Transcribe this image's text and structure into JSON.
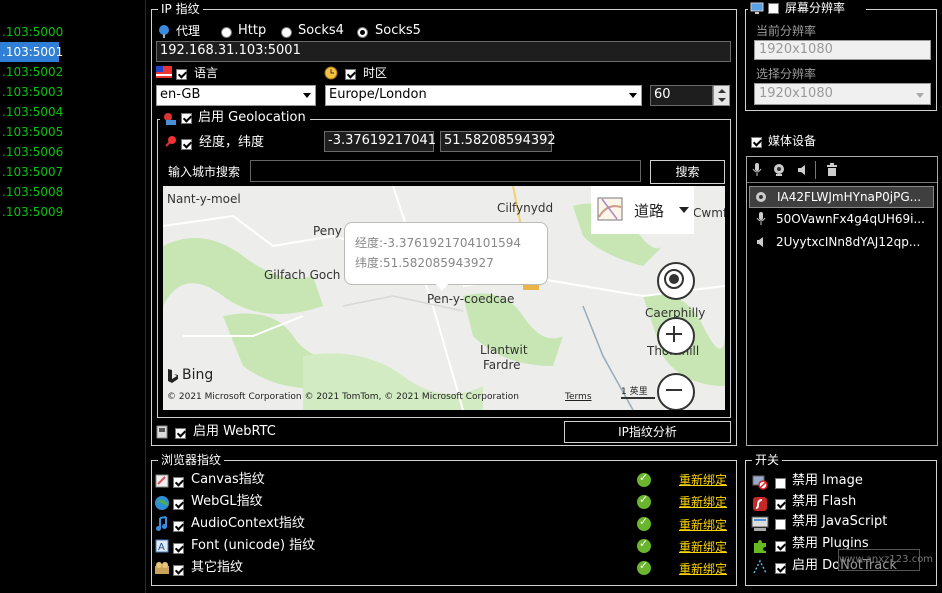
{
  "left_list": [
    ".103:5000",
    ".103:5001",
    ".103:5002",
    ".103:5003",
    ".103:5004",
    ".103:5005",
    ".103:5006",
    ".103:5007",
    ".103:5008",
    ".103:5009"
  ],
  "ip": {
    "legend": "IP 指纹",
    "proxy_label": "代理",
    "options": [
      "Http",
      "Socks4",
      "Socks5"
    ],
    "selected": "Socks5",
    "address": "192.168.31.103:5001",
    "language_label": "语言",
    "language_value": "en-GB",
    "timezone_label": "时区",
    "timezone_value": "Europe/London",
    "spin_value": "60",
    "geolocation_label": "启用 Geolocation",
    "latlon_label": "经度，纬度",
    "longitude": "-3.37619217041",
    "latitude": "51.58208594392",
    "search_label": "输入城市搜索",
    "search_button": "搜索",
    "webrtc_label": "启用 WebRTC",
    "analyze_button": "IP指纹分析"
  },
  "map": {
    "popup_lon": "经度:-3.3761921704101594",
    "popup_lat": "纬度:51.582085943927",
    "style_label": "道路",
    "labels": [
      "Nant-y-moel",
      "Cilfynydd",
      "Cwmf",
      "Peny",
      "Gilfach Goch",
      "Pen-y-coedcae",
      "Caerphilly",
      "Llantwit",
      "Fardre",
      "Thornhill"
    ],
    "brand": "Bing",
    "copyright": "© 2021 Microsoft Corporation  © 2021 TomTom, © 2021 Microsoft Corporation",
    "terms": "Terms",
    "scale": "1 英里"
  },
  "screen": {
    "legend": "屏幕分辨率",
    "current_label": "当前分辨率",
    "current_value": "1920x1080",
    "select_label": "选择分辨率",
    "select_value": "1920x1080"
  },
  "media": {
    "label": "媒体设备",
    "devices": [
      "IA42FLWJmHYnaP0jPG...",
      "50OVawnFx4g4qUH69i...",
      "2UyytxcINn8dYAJ12qp..."
    ]
  },
  "browser": {
    "legend": "浏览器指纹",
    "rebind": "重新绑定",
    "items": [
      "Canvas指纹",
      "WebGL指纹",
      "AudioContext指纹",
      "Font (unicode) 指纹",
      "其它指纹"
    ]
  },
  "switches": {
    "legend": "开关",
    "items": [
      "禁用 Image",
      "禁用 Flash",
      "禁用 JavaScript",
      "禁用 Plugins",
      "启用 DoNotTrack"
    ]
  },
  "watermark": "www.anxz123.com"
}
